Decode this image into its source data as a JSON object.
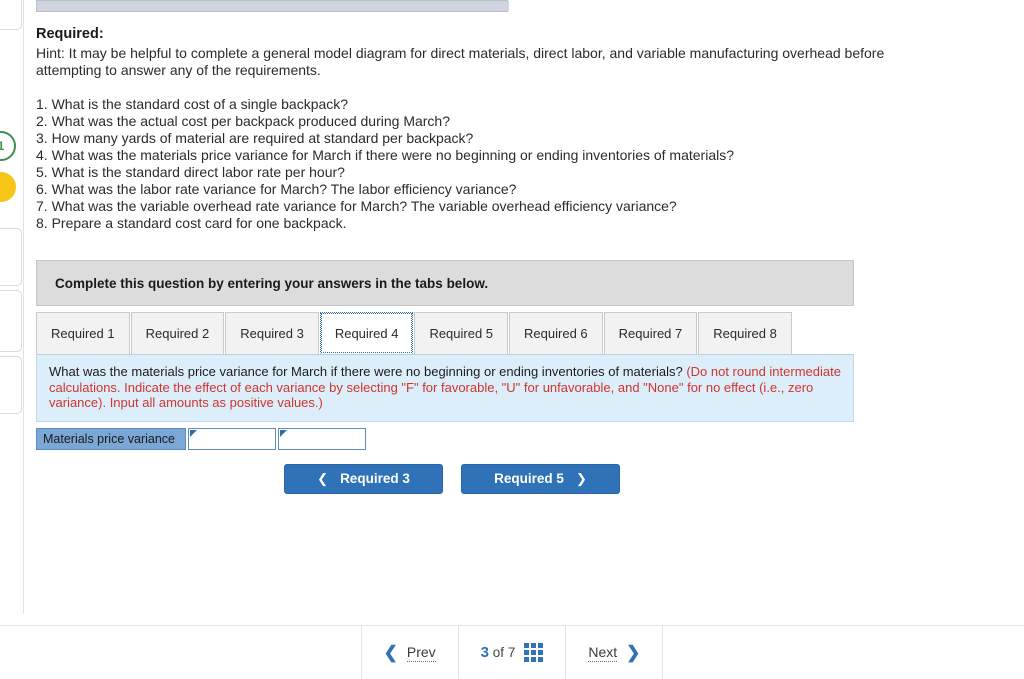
{
  "colors": {
    "accent": "#2f72b8",
    "button": "#2f72b8",
    "banner_bg": "#dcdcdc",
    "question_panel_bg": "#ddeefb",
    "note_red": "#d0342c",
    "answer_label_bg": "#7ba7d7",
    "badge_green": "#3f8f4f",
    "badge_yellow": "#f5c518"
  },
  "left_rail": {
    "badge_green_label": "1",
    "badge_yellow_label": ""
  },
  "required": {
    "heading": "Required:",
    "hint": "Hint:  It may be helpful to complete a general model diagram for direct materials, direct labor, and variable manufacturing overhead before attempting to answer any of the requirements.",
    "questions": [
      "1. What is the standard cost of a single backpack?",
      "2. What was the actual cost per backpack produced during March?",
      "3. How many yards of material are required at standard per backpack?",
      "4. What was the materials price variance for March if there were no beginning or ending inventories of materials?",
      "5. What is the standard direct labor rate per hour?",
      "6. What was the labor rate variance for March? The labor efficiency variance?",
      "7. What was the variable overhead rate variance for March? The variable overhead efficiency variance?",
      "8. Prepare a standard cost card for one backpack."
    ]
  },
  "banner": {
    "text": "Complete this question by entering your answers in the tabs below."
  },
  "tabs": [
    {
      "label": "Required 1",
      "active": false
    },
    {
      "label": "Required 2",
      "active": false
    },
    {
      "label": "Required 3",
      "active": false
    },
    {
      "label": "Required 4",
      "active": true
    },
    {
      "label": "Required 5",
      "active": false
    },
    {
      "label": "Required 6",
      "active": false
    },
    {
      "label": "Required 7",
      "active": false
    },
    {
      "label": "Required 8",
      "active": false
    }
  ],
  "question_panel": {
    "main": "What was the materials price variance for March if there were no beginning or ending inventories of materials? ",
    "note": "(Do not round intermediate calculations. Indicate the effect of each variance by selecting \"F\" for favorable, \"U\" for unfavorable, and \"None\" for no effect (i.e., zero variance). Input all amounts as positive values.)"
  },
  "answer_row": {
    "label": "Materials price variance",
    "value_amount": "",
    "value_effect": "",
    "placeholder_amount": "",
    "placeholder_effect": ""
  },
  "nav_buttons": {
    "prev_label": "Required 3",
    "prev_icon": "chevron-left-icon",
    "next_label": "Required 5",
    "next_icon": "chevron-right-icon"
  },
  "pager": {
    "prev_label": "Prev",
    "next_label": "Next",
    "current_page": "3",
    "of_label": "of",
    "total_pages": "7",
    "grid_icon": "grid-view-icon"
  }
}
